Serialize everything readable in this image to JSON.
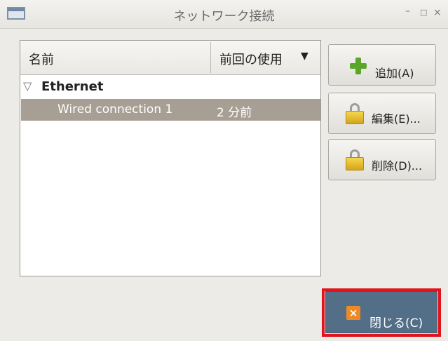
{
  "window": {
    "title": "ネットワーク接続",
    "controls": {
      "minimize": "–",
      "maximize": "□",
      "close": "×"
    }
  },
  "list": {
    "columns": {
      "name": "名前",
      "last_used": "前回の使用"
    },
    "group": {
      "label": "Ethernet"
    },
    "rows": [
      {
        "name": "Wired connection 1",
        "last_used": "2 分前"
      }
    ]
  },
  "buttons": {
    "add": "追加(A)",
    "edit": "編集(E)...",
    "delete": "削除(D)...",
    "close": "閉じる(C)"
  },
  "colors": {
    "selected_row": "#a79f94",
    "close_button": "#536e87",
    "highlight": "#e0141d"
  }
}
